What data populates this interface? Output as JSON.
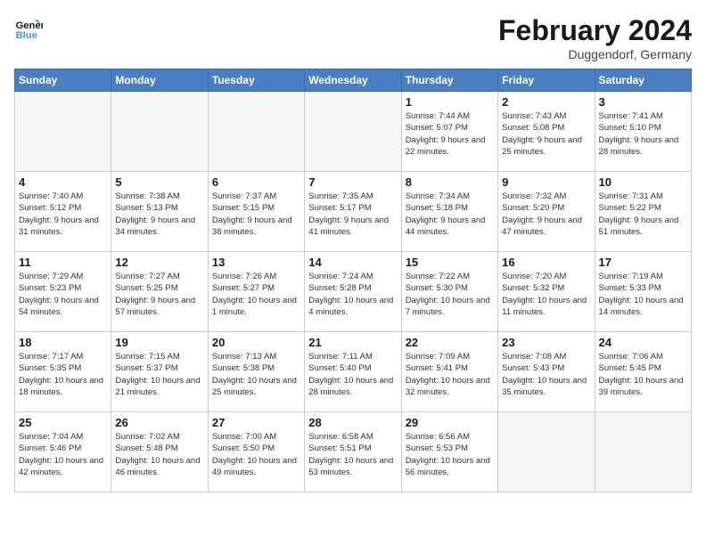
{
  "header": {
    "logo_line1": "General",
    "logo_line2": "Blue",
    "month_title": "February 2024",
    "subtitle": "Duggendorf, Germany"
  },
  "weekdays": [
    "Sunday",
    "Monday",
    "Tuesday",
    "Wednesday",
    "Thursday",
    "Friday",
    "Saturday"
  ],
  "weeks": [
    [
      {
        "day": "",
        "info": ""
      },
      {
        "day": "",
        "info": ""
      },
      {
        "day": "",
        "info": ""
      },
      {
        "day": "",
        "info": ""
      },
      {
        "day": "1",
        "info": "Sunrise: 7:44 AM\nSunset: 5:07 PM\nDaylight: 9 hours\nand 22 minutes."
      },
      {
        "day": "2",
        "info": "Sunrise: 7:43 AM\nSunset: 5:08 PM\nDaylight: 9 hours\nand 25 minutes."
      },
      {
        "day": "3",
        "info": "Sunrise: 7:41 AM\nSunset: 5:10 PM\nDaylight: 9 hours\nand 28 minutes."
      }
    ],
    [
      {
        "day": "4",
        "info": "Sunrise: 7:40 AM\nSunset: 5:12 PM\nDaylight: 9 hours\nand 31 minutes."
      },
      {
        "day": "5",
        "info": "Sunrise: 7:38 AM\nSunset: 5:13 PM\nDaylight: 9 hours\nand 34 minutes."
      },
      {
        "day": "6",
        "info": "Sunrise: 7:37 AM\nSunset: 5:15 PM\nDaylight: 9 hours\nand 38 minutes."
      },
      {
        "day": "7",
        "info": "Sunrise: 7:35 AM\nSunset: 5:17 PM\nDaylight: 9 hours\nand 41 minutes."
      },
      {
        "day": "8",
        "info": "Sunrise: 7:34 AM\nSunset: 5:18 PM\nDaylight: 9 hours\nand 44 minutes."
      },
      {
        "day": "9",
        "info": "Sunrise: 7:32 AM\nSunset: 5:20 PM\nDaylight: 9 hours\nand 47 minutes."
      },
      {
        "day": "10",
        "info": "Sunrise: 7:31 AM\nSunset: 5:22 PM\nDaylight: 9 hours\nand 51 minutes."
      }
    ],
    [
      {
        "day": "11",
        "info": "Sunrise: 7:29 AM\nSunset: 5:23 PM\nDaylight: 9 hours\nand 54 minutes."
      },
      {
        "day": "12",
        "info": "Sunrise: 7:27 AM\nSunset: 5:25 PM\nDaylight: 9 hours\nand 57 minutes."
      },
      {
        "day": "13",
        "info": "Sunrise: 7:26 AM\nSunset: 5:27 PM\nDaylight: 10 hours\nand 1 minute."
      },
      {
        "day": "14",
        "info": "Sunrise: 7:24 AM\nSunset: 5:28 PM\nDaylight: 10 hours\nand 4 minutes."
      },
      {
        "day": "15",
        "info": "Sunrise: 7:22 AM\nSunset: 5:30 PM\nDaylight: 10 hours\nand 7 minutes."
      },
      {
        "day": "16",
        "info": "Sunrise: 7:20 AM\nSunset: 5:32 PM\nDaylight: 10 hours\nand 11 minutes."
      },
      {
        "day": "17",
        "info": "Sunrise: 7:19 AM\nSunset: 5:33 PM\nDaylight: 10 hours\nand 14 minutes."
      }
    ],
    [
      {
        "day": "18",
        "info": "Sunrise: 7:17 AM\nSunset: 5:35 PM\nDaylight: 10 hours\nand 18 minutes."
      },
      {
        "day": "19",
        "info": "Sunrise: 7:15 AM\nSunset: 5:37 PM\nDaylight: 10 hours\nand 21 minutes."
      },
      {
        "day": "20",
        "info": "Sunrise: 7:13 AM\nSunset: 5:38 PM\nDaylight: 10 hours\nand 25 minutes."
      },
      {
        "day": "21",
        "info": "Sunrise: 7:11 AM\nSunset: 5:40 PM\nDaylight: 10 hours\nand 28 minutes."
      },
      {
        "day": "22",
        "info": "Sunrise: 7:09 AM\nSunset: 5:41 PM\nDaylight: 10 hours\nand 32 minutes."
      },
      {
        "day": "23",
        "info": "Sunrise: 7:08 AM\nSunset: 5:43 PM\nDaylight: 10 hours\nand 35 minutes."
      },
      {
        "day": "24",
        "info": "Sunrise: 7:06 AM\nSunset: 5:45 PM\nDaylight: 10 hours\nand 39 minutes."
      }
    ],
    [
      {
        "day": "25",
        "info": "Sunrise: 7:04 AM\nSunset: 5:46 PM\nDaylight: 10 hours\nand 42 minutes."
      },
      {
        "day": "26",
        "info": "Sunrise: 7:02 AM\nSunset: 5:48 PM\nDaylight: 10 hours\nand 46 minutes."
      },
      {
        "day": "27",
        "info": "Sunrise: 7:00 AM\nSunset: 5:50 PM\nDaylight: 10 hours\nand 49 minutes."
      },
      {
        "day": "28",
        "info": "Sunrise: 6:58 AM\nSunset: 5:51 PM\nDaylight: 10 hours\nand 53 minutes."
      },
      {
        "day": "29",
        "info": "Sunrise: 6:56 AM\nSunset: 5:53 PM\nDaylight: 10 hours\nand 56 minutes."
      },
      {
        "day": "",
        "info": ""
      },
      {
        "day": "",
        "info": ""
      }
    ]
  ]
}
